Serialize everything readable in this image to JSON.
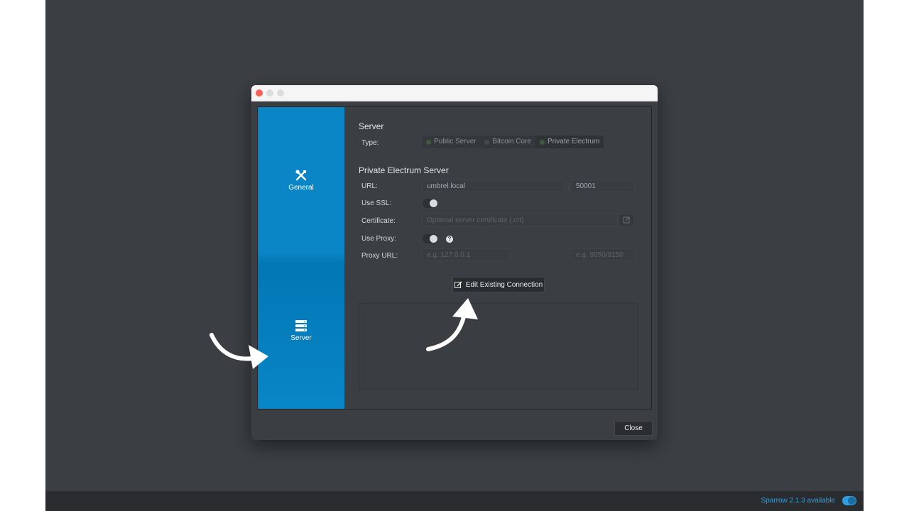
{
  "status_bar": {
    "update_text": "Sparrow 2.1.3 available"
  },
  "sidebar": {
    "items": [
      {
        "label": "General",
        "icon": "tools-icon"
      },
      {
        "label": "Server",
        "icon": "server-icon"
      }
    ]
  },
  "server_section": {
    "title": "Server",
    "type_label": "Type:",
    "types": [
      {
        "label": "Public Server",
        "selected": false
      },
      {
        "label": "Bitcoin Core",
        "selected": false
      },
      {
        "label": "Private Electrum",
        "selected": true
      }
    ]
  },
  "private_electrum": {
    "title": "Private Electrum Server",
    "url_label": "URL:",
    "url_value": "umbrel.local",
    "port_separator": ":",
    "port_value": "50001",
    "use_ssl_label": "Use SSL:",
    "certificate_label": "Certificate:",
    "certificate_placeholder": "Optional server certificate (.crt)",
    "use_proxy_label": "Use Proxy:",
    "proxy_help": "?",
    "proxy_url_label": "Proxy URL:",
    "proxy_host_placeholder": "e.g. 127.0.0.1",
    "proxy_port_placeholder": "e.g. 9050/9150"
  },
  "actions": {
    "edit_connection_label": "Edit Existing Connection",
    "close_label": "Close"
  },
  "colors": {
    "sidebar_blue": "#0a86c6",
    "status_accent": "#2d9ee0",
    "window_close": "#fe5f57"
  }
}
